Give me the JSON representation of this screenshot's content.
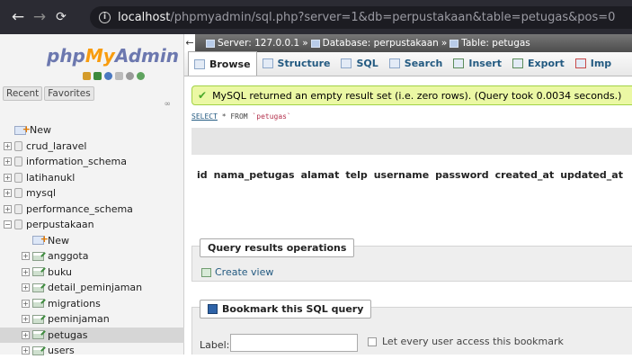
{
  "browser": {
    "url_host": "localhost",
    "url_rest": "/phpmyadmin/sql.php?server=1&db=perpustakaan&table=petugas&pos=0"
  },
  "sidebar": {
    "logo_php": "php",
    "logo_my": "My",
    "logo_admin": "Admin",
    "recent_label": "Recent",
    "favorites_label": "Favorites",
    "tree": [
      {
        "label": "New",
        "level": 0,
        "type": "new"
      },
      {
        "label": "crud_laravel",
        "level": 0,
        "type": "db"
      },
      {
        "label": "information_schema",
        "level": 0,
        "type": "db"
      },
      {
        "label": "latihanukl",
        "level": 0,
        "type": "db"
      },
      {
        "label": "mysql",
        "level": 0,
        "type": "db"
      },
      {
        "label": "performance_schema",
        "level": 0,
        "type": "db"
      },
      {
        "label": "perpustakaan",
        "level": 0,
        "type": "db-open"
      },
      {
        "label": "New",
        "level": 1,
        "type": "new"
      },
      {
        "label": "anggota",
        "level": 1,
        "type": "table"
      },
      {
        "label": "buku",
        "level": 1,
        "type": "table"
      },
      {
        "label": "detail_peminjaman",
        "level": 1,
        "type": "table"
      },
      {
        "label": "migrations",
        "level": 1,
        "type": "table"
      },
      {
        "label": "peminjaman",
        "level": 1,
        "type": "table"
      },
      {
        "label": "petugas",
        "level": 1,
        "type": "table",
        "selected": true
      },
      {
        "label": "users",
        "level": 1,
        "type": "table"
      }
    ]
  },
  "breadcrumb": {
    "server": "Server: 127.0.0.1",
    "database": "Database: perpustakaan",
    "table": "Table: petugas"
  },
  "tabs": [
    "Browse",
    "Structure",
    "SQL",
    "Search",
    "Insert",
    "Export",
    "Imp"
  ],
  "message": "MySQL returned an empty result set (i.e. zero rows). (Query took 0.0034 seconds.)",
  "sql": {
    "select": "SELECT",
    "rest": " * FROM ",
    "table": "`petugas`"
  },
  "columns": [
    "id",
    "nama_petugas",
    "alamat",
    "telp",
    "username",
    "password",
    "created_at",
    "updated_at"
  ],
  "qro": {
    "legend": "Query results operations",
    "create_view": "Create view"
  },
  "bookmark": {
    "legend": "Bookmark this SQL query",
    "label": "Label:",
    "checkbox": "Let every user access this bookmark"
  },
  "colors": {
    "accent": "#235a81",
    "success_bg": "#ebf8a4",
    "selected": "#d6d6d6"
  }
}
